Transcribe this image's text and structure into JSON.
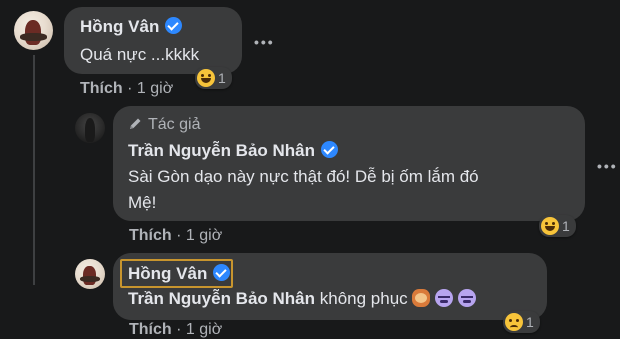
{
  "comments": [
    {
      "author": "Hồng Vân",
      "text": "Quá nực ...kkkk",
      "like_label": "Thích",
      "time": "1 giờ",
      "reaction_count": "1",
      "reaction_icon": "haha-emoji-icon"
    },
    {
      "badge": "Tác giả",
      "author": "Trần Nguyễn Bảo Nhân",
      "text_line1": "Sài Gòn dạo này nực thật đó! Dễ bị ốm lắm đó",
      "text_line2": "Mệ!",
      "like_label": "Thích",
      "time": "1 giờ",
      "reaction_count": "1",
      "reaction_icon": "haha-emoji-icon"
    },
    {
      "author": "Hồng Vân",
      "mention": "Trần Nguyễn Bảo Nhân",
      "text": " không phục",
      "inline_emojis": [
        "monkey-face-emoji-icon",
        "dizzy-face-emoji-icon",
        "dizzy-face-emoji-icon"
      ],
      "like_label": "Thích",
      "time": "1 giờ",
      "reaction_count": "1",
      "reaction_icon": "sad-emoji-icon"
    }
  ],
  "colors": {
    "background": "#18191a",
    "bubble": "#3a3b3c",
    "verified": "#2d88ff",
    "highlight": "#c8952e"
  }
}
